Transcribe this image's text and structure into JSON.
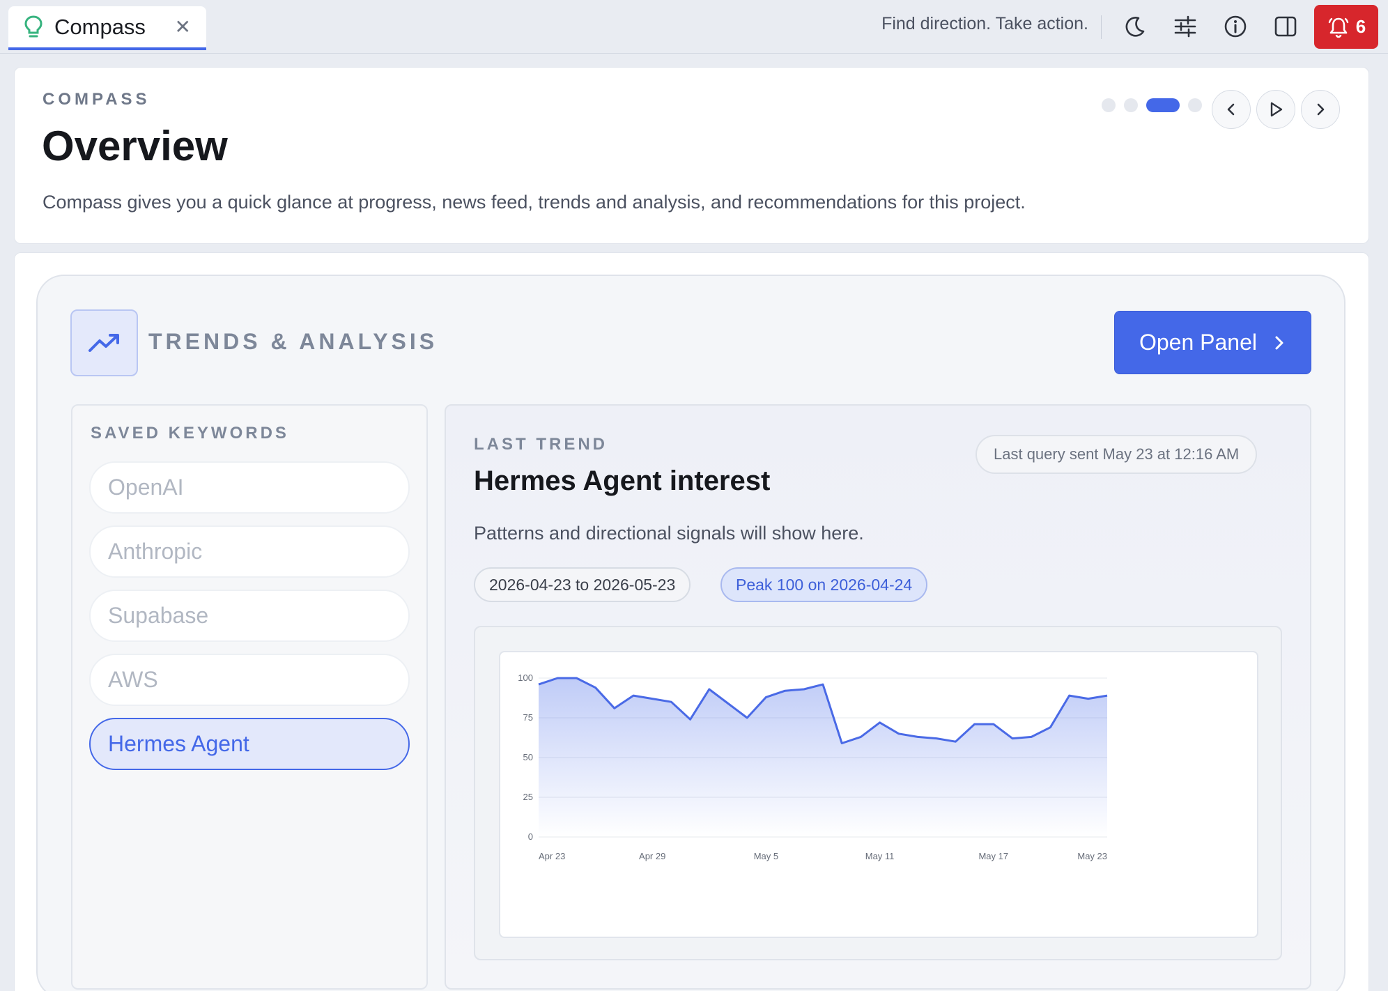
{
  "tab": {
    "label": "Compass",
    "icon": "lightbulb-icon",
    "close_glyph": "✕"
  },
  "topbar": {
    "tagline": "Find direction. Take action.",
    "icons": [
      "moon-icon",
      "sliders-icon",
      "info-icon",
      "panel-icon"
    ],
    "alert_count": "6"
  },
  "overview": {
    "eyebrow": "COMPASS",
    "title": "Overview",
    "description": "Compass gives you a quick glance at progress, news feed, trends and analysis, and recommendations for this project.",
    "carousel_active_index": 2,
    "carousel_count": 4
  },
  "section": {
    "title": "TRENDS & ANALYSIS",
    "open_button": "Open Panel"
  },
  "keywords": {
    "heading": "SAVED KEYWORDS",
    "items": [
      {
        "label": "OpenAI",
        "active": false
      },
      {
        "label": "Anthropic",
        "active": false
      },
      {
        "label": "Supabase",
        "active": false
      },
      {
        "label": "AWS",
        "active": false
      },
      {
        "label": "Hermes Agent",
        "active": true
      }
    ]
  },
  "trend": {
    "eyebrow": "LAST TREND",
    "title": "Hermes Agent interest",
    "description": "Patterns and directional signals will show here.",
    "last_query": "Last query sent May 23 at 12:16 AM",
    "range_pill": "2026-04-23 to 2026-05-23",
    "peak_pill": "Peak 100 on 2026-04-24"
  },
  "colors": {
    "accent": "#4468e8",
    "alert": "#d7262c",
    "line": "#4a6ae6"
  },
  "chart_data": {
    "type": "area",
    "title": "",
    "xlabel": "",
    "ylabel": "",
    "x_tick_labels": [
      "Apr 23",
      "Apr 29",
      "May 5",
      "May 11",
      "May 17",
      "May 23"
    ],
    "x_tick_index": [
      0,
      6,
      12,
      18,
      24,
      30
    ],
    "y_ticks": [
      0,
      25,
      50,
      75,
      100
    ],
    "ylim": [
      0,
      100
    ],
    "grid": true,
    "x": [
      "Apr 23",
      "Apr 24",
      "Apr 25",
      "Apr 26",
      "Apr 27",
      "Apr 28",
      "Apr 29",
      "Apr 30",
      "May 1",
      "May 2",
      "May 3",
      "May 4",
      "May 5",
      "May 6",
      "May 7",
      "May 8",
      "May 9",
      "May 10",
      "May 11",
      "May 12",
      "May 13",
      "May 14",
      "May 15",
      "May 16",
      "May 17",
      "May 18",
      "May 19",
      "May 20",
      "May 21",
      "May 22",
      "May 23"
    ],
    "values": [
      96,
      100,
      100,
      94,
      81,
      89,
      87,
      85,
      74,
      93,
      84,
      75,
      88,
      92,
      93,
      96,
      59,
      63,
      72,
      65,
      63,
      62,
      60,
      71,
      71,
      62,
      63,
      69,
      89,
      87,
      89
    ]
  }
}
